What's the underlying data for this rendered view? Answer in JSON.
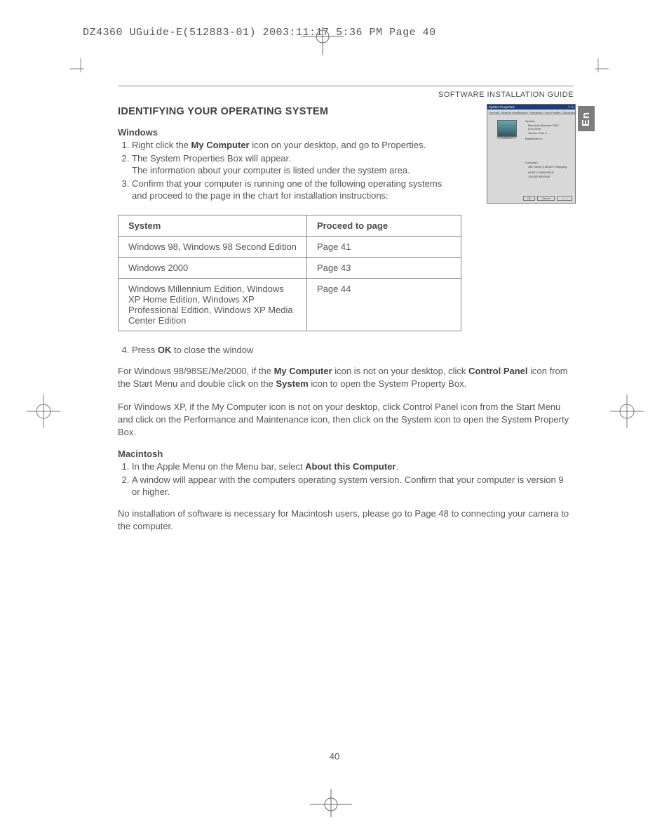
{
  "header_line": "DZ4360 UGuide-E(512883-01)  2003:11:17  5:36 PM  Page 40",
  "section_label": "SOFTWARE INSTALLATION GUIDE",
  "heading": "IDENTIFYING YOUR OPERATING SYSTEM",
  "lang_tab": "En",
  "windows": {
    "title": "Windows",
    "step1_a": "Right click the ",
    "step1_b": "My Computer",
    "step1_c": " icon on your desktop, and go to Properties.",
    "step2": "The System Properties Box will appear.",
    "step2_note": "The information about your computer is listed under the system area.",
    "step3": "Confirm that your computer is running one of the following operating systems and proceed to the page in the chart for installation instructions:"
  },
  "table": {
    "h1": "System",
    "h2": "Proceed to page",
    "rows": [
      {
        "sys": "Windows 98, Windows 98 Second Edition",
        "page": "Page 41"
      },
      {
        "sys": "Windows 2000",
        "page": "Page 43"
      },
      {
        "sys": "Windows Millennium Edition, Windows XP Home Edition, Windows XP Professional Edition, Windows XP Media Center Edition",
        "page": "Page 44"
      }
    ]
  },
  "step4_a": "Press ",
  "step4_b": "OK",
  "step4_c": " to close the window",
  "note_98_a": "For Windows 98/98SE/Me/2000, if the ",
  "note_98_b": "My Computer",
  "note_98_c": " icon is not on your desktop, click ",
  "note_98_d": "Control Panel",
  "note_98_e": " icon from the Start Menu and double click on the ",
  "note_98_f": "System",
  "note_98_g": " icon to open the System Property Box.",
  "note_xp": "For Windows XP, if the My Computer icon is not on your desktop, click Control Panel icon from the Start Menu and click on the Performance and Maintenance icon, then click on the System icon to open the System Property Box.",
  "mac": {
    "title": "Macintosh",
    "step1_a": "In the Apple Menu on the Menu bar, select ",
    "step1_b": "About this Computer",
    "step1_c": ".",
    "step2": "A window will appear with the computers operating system version. Confirm that your computer is version 9 or higher."
  },
  "mac_note": "No installation of software is necessary for Macintosh users, please go to Page 48 to connecting your camera to the computer.",
  "page_number": "40",
  "shot": {
    "title": "System Properties",
    "tabs": "General | Network Identification | Hardware | User Profiles | Advanced",
    "sys_label": "System:",
    "sys1": "Microsoft Windows 2000",
    "sys2": "5.00.2195",
    "sys3": "Service Pack 3",
    "reg": "Registered to:",
    "comp_label": "Computer:",
    "comp1": "x86 Family 6 Model 7 Stepping",
    "comp2": "AT/AT COMPATIBLE",
    "comp3": "130,552 KB RAM",
    "ok": "OK",
    "cancel": "Cancel",
    "apply": "Apply"
  }
}
